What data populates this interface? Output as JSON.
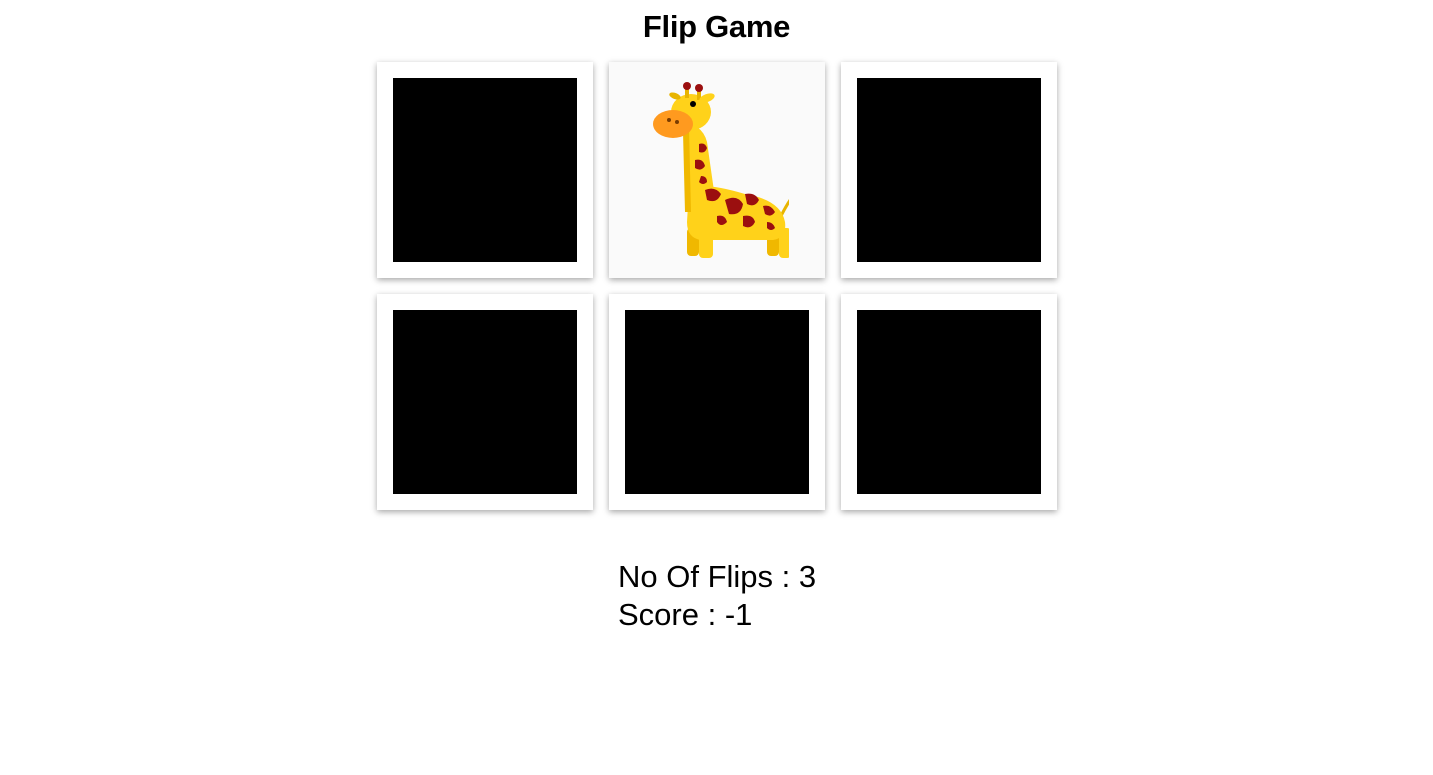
{
  "game": {
    "title": "Flip Game"
  },
  "cards": [
    {
      "state": "face-down",
      "face": null
    },
    {
      "state": "face-up",
      "face": "giraffe"
    },
    {
      "state": "face-down",
      "face": null
    },
    {
      "state": "face-down",
      "face": null
    },
    {
      "state": "face-down",
      "face": null
    },
    {
      "state": "face-down",
      "face": null
    }
  ],
  "stats": {
    "flips_label": "No Of Flips : ",
    "flips_value": "3",
    "score_label": "Score : ",
    "score_value": "-1"
  },
  "colors": {
    "card_back": "#000000",
    "card_frame": "#ffffff",
    "giraffe_body": "#ffd21a",
    "giraffe_spots": "#9b0f0f",
    "giraffe_snout": "#ff9a1f"
  }
}
